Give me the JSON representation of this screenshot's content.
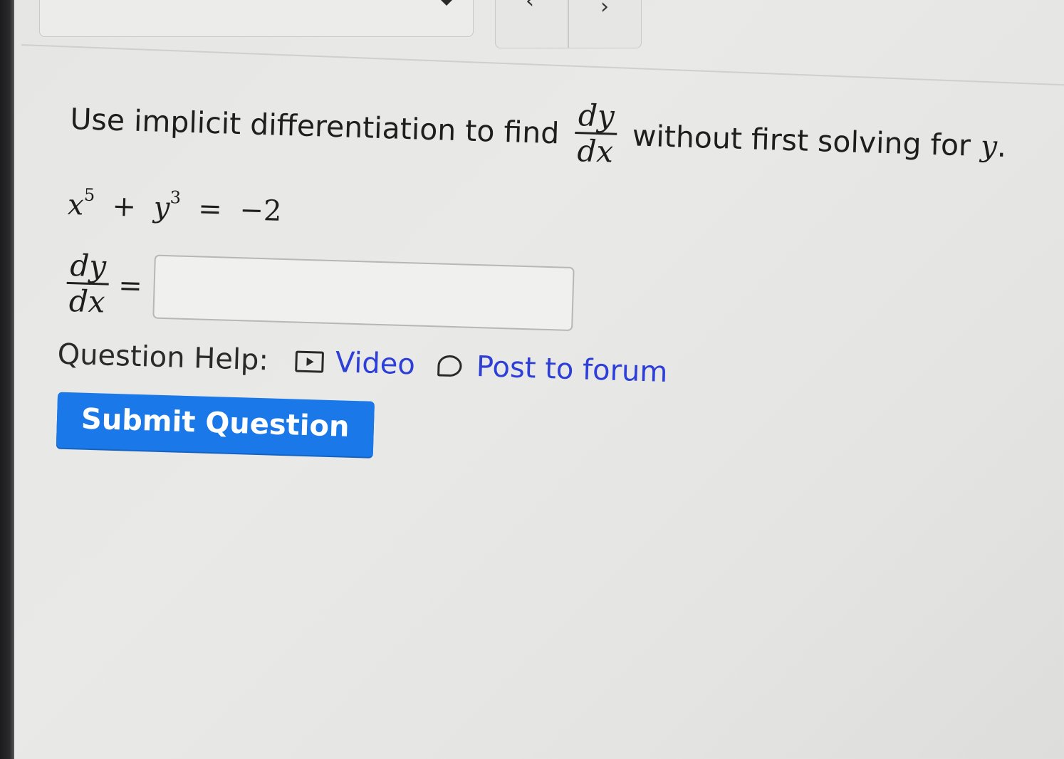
{
  "nav": {
    "prev_label": "‹",
    "next_label": "›"
  },
  "question": {
    "prompt_before": "Use implicit differentiation to find",
    "frac_num": "dy",
    "frac_den": "dx",
    "prompt_after": "without first solving for",
    "variable": "y",
    "period": ".",
    "equation": {
      "term1_base": "x",
      "term1_exp": "5",
      "plus": "+",
      "term2_base": "y",
      "term2_exp": "3",
      "equals": "=",
      "rhs": "−2"
    },
    "answer_lhs_num": "dy",
    "answer_lhs_den": "dx",
    "answer_equals": "=",
    "answer_value": ""
  },
  "help": {
    "label": "Question Help:",
    "video_label": "Video",
    "forum_label": "Post to forum"
  },
  "submit_label": "Submit Question",
  "colors": {
    "accent": "#1a78e8",
    "link": "#2d3fd8"
  }
}
